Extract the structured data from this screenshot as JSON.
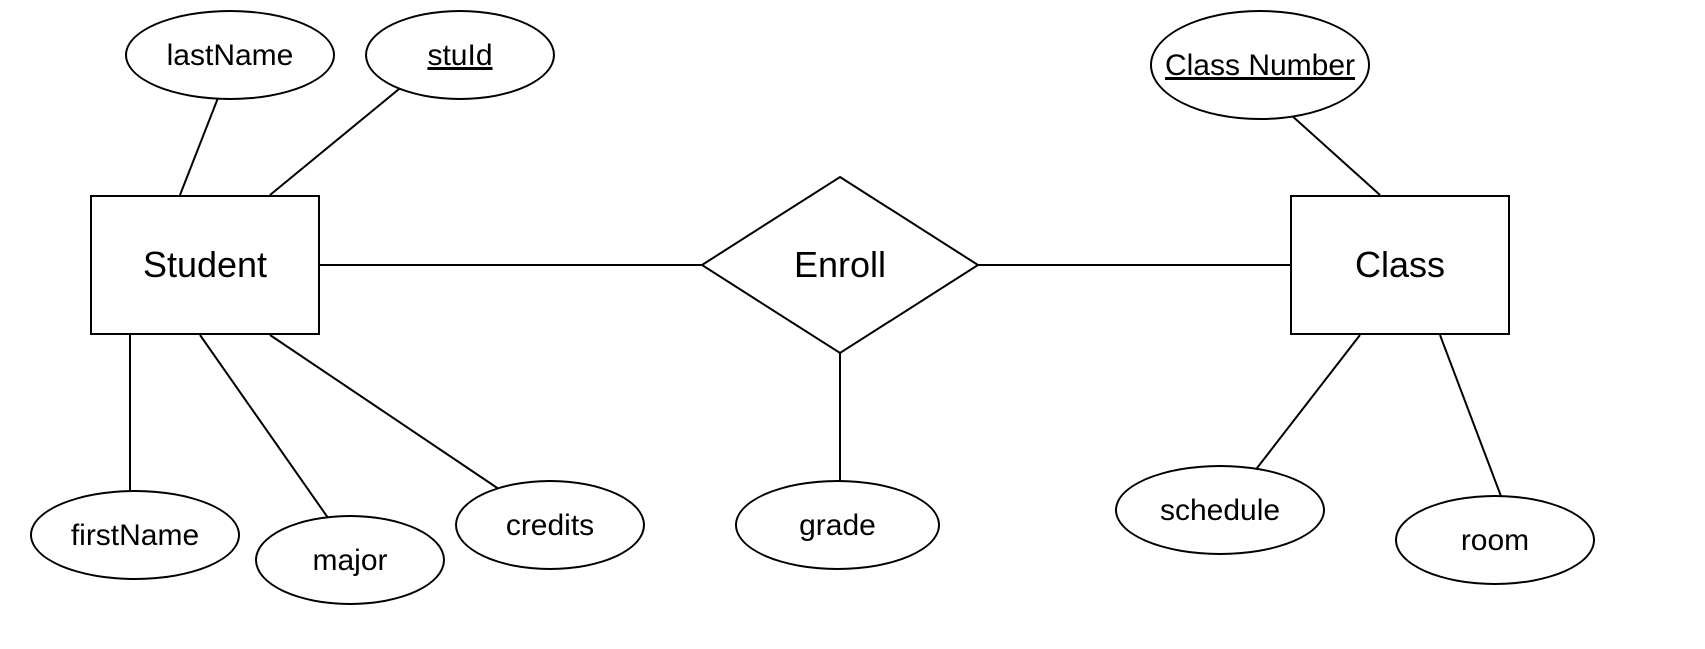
{
  "entities": {
    "student": {
      "label": "Student"
    },
    "class": {
      "label": "Class"
    }
  },
  "relationships": {
    "enroll": {
      "label": "Enroll"
    }
  },
  "attributes": {
    "lastName": {
      "label": "lastName",
      "isKey": false
    },
    "stuId": {
      "label": "stuId",
      "isKey": true
    },
    "firstName": {
      "label": "firstName",
      "isKey": false
    },
    "major": {
      "label": "major",
      "isKey": false
    },
    "credits": {
      "label": "credits",
      "isKey": false
    },
    "grade": {
      "label": "grade",
      "isKey": false
    },
    "classNumber": {
      "label": "Class Number",
      "isKey": true
    },
    "schedule": {
      "label": "schedule",
      "isKey": false
    },
    "room": {
      "label": "room",
      "isKey": false
    }
  }
}
